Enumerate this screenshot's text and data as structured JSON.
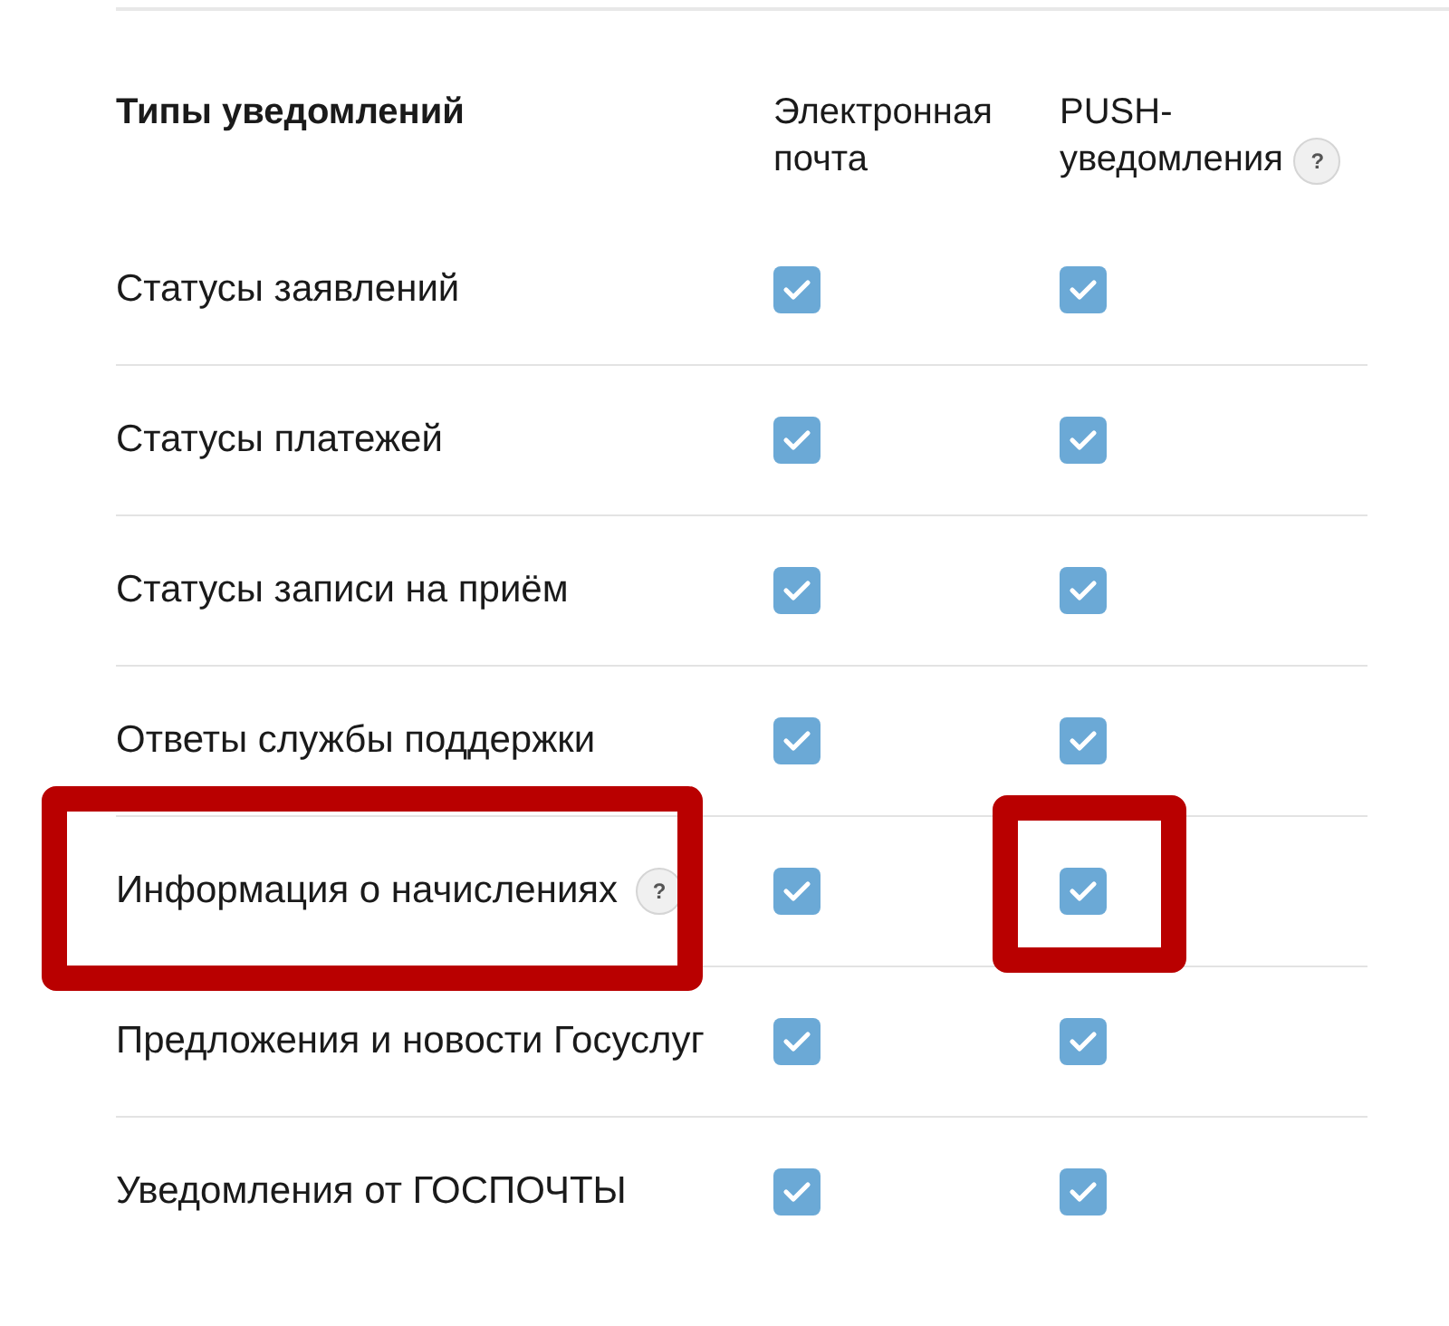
{
  "header": {
    "title": "Типы уведомлений",
    "columns": [
      {
        "label": "Электронная почта"
      },
      {
        "label": "PUSH-уведомления",
        "help": "?"
      }
    ]
  },
  "rows": [
    {
      "label": "Статусы заявлений",
      "label_highlighted": false,
      "email": {
        "checked": true,
        "highlighted": false
      },
      "push": {
        "checked": true,
        "highlighted": false
      }
    },
    {
      "label": "Статусы платежей",
      "label_highlighted": false,
      "email": {
        "checked": true,
        "highlighted": false
      },
      "push": {
        "checked": true,
        "highlighted": false
      }
    },
    {
      "label": "Статусы записи на приём",
      "label_highlighted": false,
      "email": {
        "checked": true,
        "highlighted": false
      },
      "push": {
        "checked": true,
        "highlighted": false
      }
    },
    {
      "label": "Ответы службы поддержки",
      "label_highlighted": false,
      "email": {
        "checked": true,
        "highlighted": false
      },
      "push": {
        "checked": true,
        "highlighted": false
      }
    },
    {
      "label": "Информация о начислениях",
      "help": "?",
      "label_highlighted": true,
      "email": {
        "checked": true,
        "highlighted": false
      },
      "push": {
        "checked": true,
        "highlighted": true
      }
    },
    {
      "label": "Предложения и новости Госуслуг",
      "label_highlighted": false,
      "email": {
        "checked": true,
        "highlighted": false
      },
      "push": {
        "checked": true,
        "highlighted": false
      }
    },
    {
      "label": "Уведомления от ГОСПОЧТЫ",
      "label_highlighted": false,
      "email": {
        "checked": true,
        "highlighted": false
      },
      "push": {
        "checked": true,
        "highlighted": false
      }
    }
  ]
}
